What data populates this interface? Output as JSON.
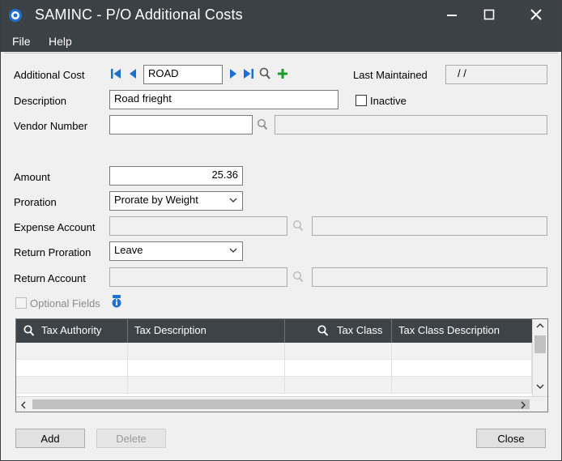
{
  "window": {
    "title": "SAMINC - P/O Additional Costs",
    "icons": {
      "app": "gear-icon",
      "minimize": "minimize-icon",
      "maximize": "maximize-icon",
      "close": "close-icon"
    }
  },
  "menu": [
    {
      "label": "File"
    },
    {
      "label": "Help"
    }
  ],
  "form": {
    "additional_cost": {
      "label": "Additional Cost",
      "value": "ROAD"
    },
    "last_maintained": {
      "label": "Last Maintained",
      "value": "/ /"
    },
    "description": {
      "label": "Description",
      "value": "Road frieght"
    },
    "inactive": {
      "label": "Inactive",
      "checked": false
    },
    "vendor_number": {
      "label": "Vendor Number",
      "value": "",
      "name": ""
    },
    "amount": {
      "label": "Amount",
      "value": "25.36"
    },
    "proration": {
      "label": "Proration",
      "value": "Prorate by Weight"
    },
    "expense_account": {
      "label": "Expense Account",
      "value": "",
      "description": ""
    },
    "return_proration": {
      "label": "Return Proration",
      "value": "Leave"
    },
    "return_account": {
      "label": "Return Account",
      "value": "",
      "description": ""
    },
    "optional_fields": {
      "label": "Optional Fields",
      "checked": false,
      "enabled": false
    }
  },
  "tax_grid": {
    "columns": [
      "Tax Authority",
      "Tax Description",
      "Tax Class",
      "Tax Class Description"
    ],
    "rows": [
      [
        "",
        "",
        "",
        ""
      ],
      [
        "",
        "",
        "",
        ""
      ],
      [
        "",
        "",
        "",
        ""
      ]
    ]
  },
  "buttons": {
    "add": "Add",
    "delete": "Delete",
    "close": "Close"
  },
  "colors": {
    "titlebar": "#3c4146",
    "nav_blue": "#1e6fd0",
    "add_green": "#1d9a2c",
    "grid_header": "#3e4347"
  }
}
